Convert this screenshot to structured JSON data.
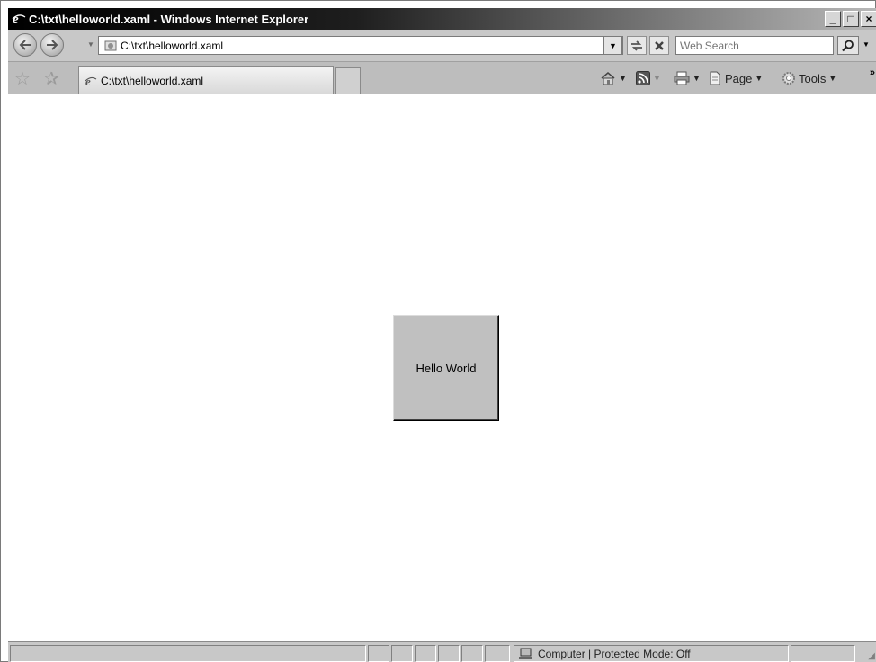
{
  "window": {
    "title": "C:\\txt\\helloworld.xaml - Windows Internet Explorer",
    "controls": {
      "minimize": "_",
      "maximize": "□",
      "close": "×"
    }
  },
  "address_bar": {
    "url": "C:\\txt\\helloworld.xaml",
    "search_placeholder": "Web Search"
  },
  "tabs": [
    {
      "label": "C:\\txt\\helloworld.xaml"
    }
  ],
  "command_bar": {
    "page_label": "Page",
    "tools_label": "Tools"
  },
  "content": {
    "button_label": "Hello World"
  },
  "status_bar": {
    "zone_text": "Computer | Protected Mode: Off"
  },
  "icons": [
    "ie-logo-icon",
    "back-icon",
    "forward-icon",
    "page-icon",
    "refresh-icon",
    "stop-icon",
    "search-icon",
    "favorites-star-icon",
    "add-favorites-icon",
    "home-icon",
    "feeds-icon",
    "print-icon",
    "page-menu-icon",
    "tools-gear-icon",
    "computer-zone-icon"
  ]
}
